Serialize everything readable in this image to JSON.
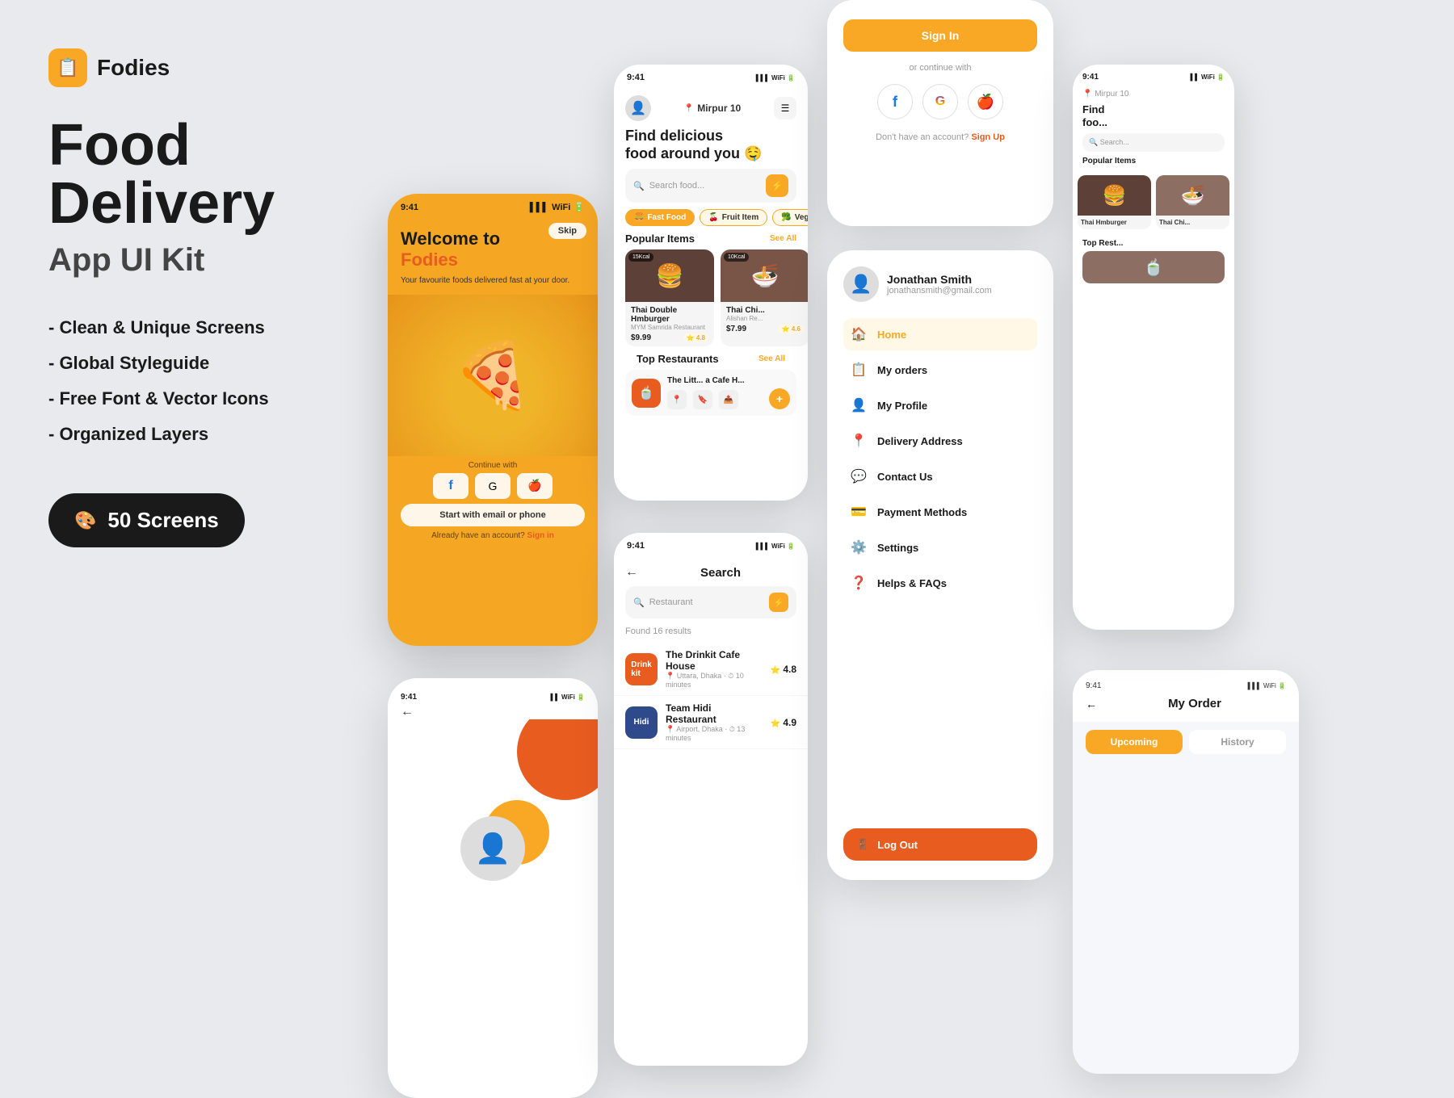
{
  "brand": {
    "name": "Fodies",
    "icon": "📋"
  },
  "hero": {
    "title1": "Food",
    "title2": "Delivery",
    "subtitle": "App UI Kit"
  },
  "features": [
    "- Clean & Unique Screens",
    "- Global Styleguide",
    "- Free Font & Vector Icons",
    "- Organized Layers"
  ],
  "badge": {
    "count": "50",
    "label": "Screens"
  },
  "phone1": {
    "time": "9:41",
    "skip": "Skip",
    "welcome_line1": "Welcome to",
    "welcome_fodies": "Fodies",
    "tagline": "Your favourite foods delivered fast at your door.",
    "continue_text": "Continue with",
    "start_btn": "Start with email or phone",
    "signin_text": "Already have an account?",
    "signin_link": "Sign in"
  },
  "main_screen": {
    "time": "9:41",
    "location": "Mirpur 10",
    "find_text": "Find delicious",
    "food_text": "food around you",
    "emoji": "🤤",
    "search_placeholder": "Search food...",
    "categories": [
      {
        "label": "Fast Food",
        "icon": "🍔",
        "active": true
      },
      {
        "label": "Fruit Item",
        "icon": "🍒",
        "active": false
      },
      {
        "label": "Vegetable",
        "icon": "🥦",
        "active": false
      }
    ],
    "popular_label": "Popular Items",
    "see_all": "See All",
    "popular_items": [
      {
        "name": "Thai Double Hmburger",
        "restaurant": "MYM Samrida Restaurant",
        "price": "$9.99",
        "rating": "4.8",
        "cal": "15Kcal",
        "emoji": "🍔"
      },
      {
        "name": "Thai Chi...",
        "restaurant": "Alishan Re...",
        "price": "$7.99",
        "rating": "4.6",
        "cal": "10Kcal",
        "emoji": "🍜"
      }
    ],
    "top_restaurants_label": "Top Restaurants",
    "top_restaurant": {
      "name": "The Litt...",
      "sub": "a Cafe H...",
      "icon": "🍵"
    }
  },
  "search_screen": {
    "time": "9:41",
    "title": "Search",
    "placeholder": "Restaurant",
    "found_text": "Found 16 results",
    "restaurants": [
      {
        "name": "The Drinkit Cafe House",
        "location": "Uttara, Dhaka",
        "time": "10 minutes",
        "rating": "4.8",
        "logo": "Drinkit"
      },
      {
        "name": "Team Hidi Restaurant",
        "location": "Airport, Dhaka",
        "time": "13 minutes",
        "rating": "4.9",
        "logo": "Hidi"
      }
    ]
  },
  "signin_panel": {
    "signin_label": "Sign In",
    "or_continue": "or continue with",
    "no_account": "Don't have an account?",
    "signup_link": "Sign Up"
  },
  "sidebar_nav": {
    "user": {
      "name": "Jonathan Smith",
      "email": "jonathansmith@gmail.com"
    },
    "items": [
      {
        "label": "Home",
        "icon": "🏠",
        "active": true
      },
      {
        "label": "My orders",
        "icon": "📋",
        "active": false
      },
      {
        "label": "My Profile",
        "icon": "👤",
        "active": false
      },
      {
        "label": "Delivery Address",
        "icon": "📍",
        "active": false
      },
      {
        "label": "Contact Us",
        "icon": "💬",
        "active": false
      },
      {
        "label": "Payment Methods",
        "icon": "💳",
        "active": false
      },
      {
        "label": "Settings",
        "icon": "⚙️",
        "active": false
      },
      {
        "label": "Helps & FAQs",
        "icon": "❓",
        "active": false
      }
    ],
    "logout": "Log Out"
  },
  "myorder": {
    "time": "9:41",
    "title": "My Order",
    "tab_upcoming": "Upcoming",
    "tab_history": "History"
  },
  "colors": {
    "primary": "#F9A825",
    "accent": "#E85C20",
    "dark": "#1a1a1a",
    "white": "#ffffff",
    "bg": "#e8eaed"
  }
}
